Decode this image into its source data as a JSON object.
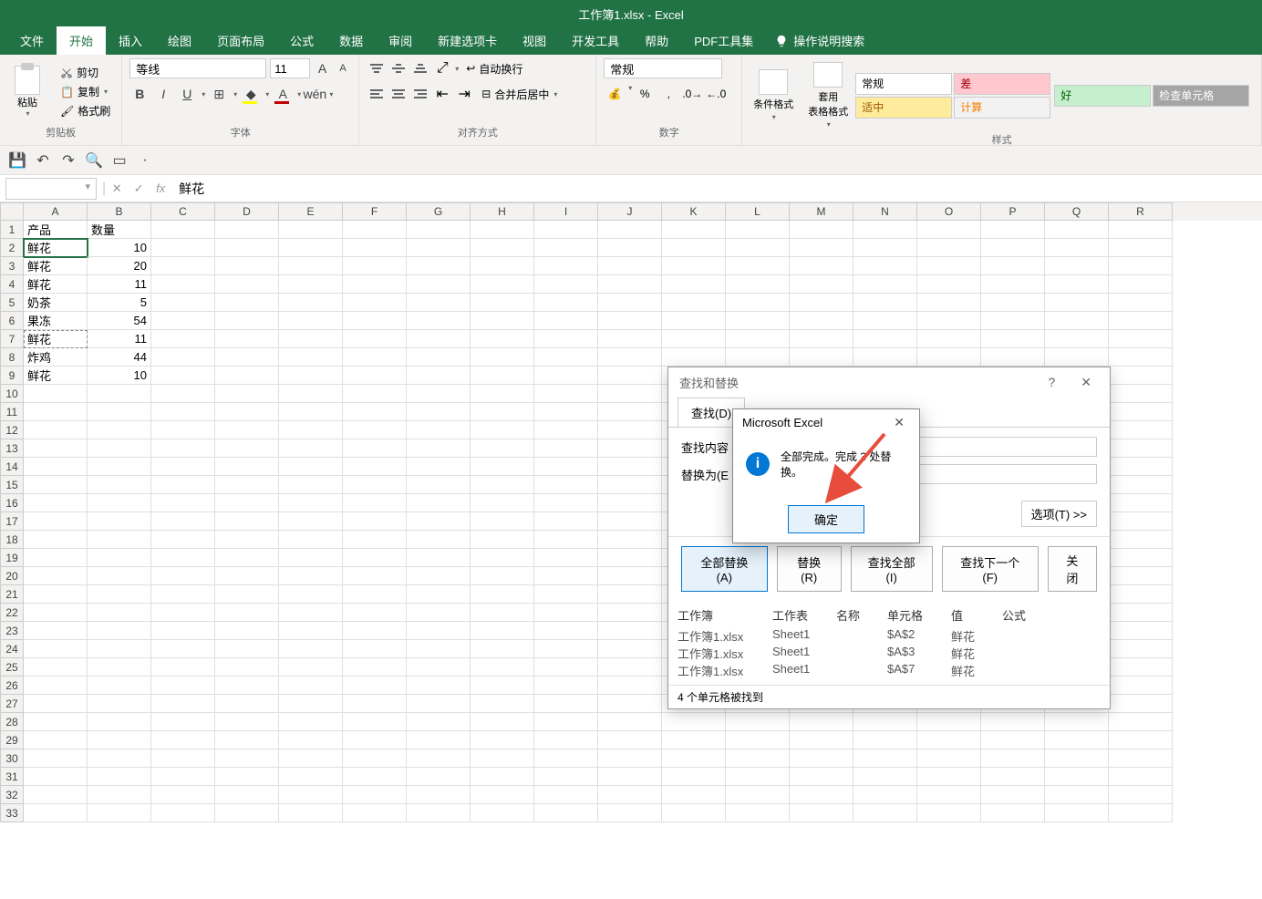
{
  "app": {
    "title": "工作簿1.xlsx - Excel"
  },
  "tabs": {
    "file": "文件",
    "home": "开始",
    "insert": "插入",
    "draw": "绘图",
    "layout": "页面布局",
    "formulas": "公式",
    "data": "数据",
    "review": "审阅",
    "newtab": "新建选项卡",
    "view": "视图",
    "developer": "开发工具",
    "help": "帮助",
    "pdf": "PDF工具集",
    "tellme": "操作说明搜索"
  },
  "ribbon": {
    "clipboard": {
      "label": "剪贴板",
      "paste": "粘贴",
      "cut": "剪切",
      "copy": "复制",
      "format_painter": "格式刷"
    },
    "font": {
      "label": "字体",
      "name": "等线",
      "size": "11"
    },
    "alignment": {
      "label": "对齐方式",
      "wrap": "自动换行",
      "merge": "合并后居中"
    },
    "number": {
      "label": "数字",
      "format": "常规"
    },
    "styles": {
      "label": "样式",
      "cond_format": "条件格式",
      "table_format": "套用\n表格格式",
      "normal": "常规",
      "bad": "差",
      "good": "好",
      "neutral": "适中",
      "calc": "计算",
      "check": "检查单元格"
    }
  },
  "formula_bar": {
    "name_box": "",
    "value": "鲜花"
  },
  "columns": [
    "A",
    "B",
    "C",
    "D",
    "E",
    "F",
    "G",
    "H",
    "I",
    "J",
    "K",
    "L",
    "M",
    "N",
    "O",
    "P",
    "Q",
    "R"
  ],
  "sheet": {
    "headers": {
      "a": "产品",
      "b": "数量"
    },
    "rows": [
      {
        "a": "鲜花",
        "b": "10"
      },
      {
        "a": "鲜花",
        "b": "20"
      },
      {
        "a": "鲜花",
        "b": "11"
      },
      {
        "a": "奶茶",
        "b": "5"
      },
      {
        "a": "果冻",
        "b": "54"
      },
      {
        "a": "鲜花",
        "b": "11"
      },
      {
        "a": "炸鸡",
        "b": "44"
      },
      {
        "a": "鲜花",
        "b": "10"
      }
    ]
  },
  "find_replace": {
    "title": "查找和替换",
    "tab_find": "查找(D)",
    "find_label": "查找内容",
    "replace_label": "替换为(E",
    "options": "选项(T) >>",
    "replace_all": "全部替换(A)",
    "replace": "替换(R)",
    "find_all": "查找全部(I)",
    "find_next": "查找下一个(F)",
    "close": "关闭",
    "cols": {
      "book": "工作簿",
      "sheet": "工作表",
      "name": "名称",
      "cell": "单元格",
      "value": "值",
      "formula": "公式"
    },
    "results": [
      {
        "book": "工作簿1.xlsx",
        "sheet": "Sheet1",
        "cell": "$A$2",
        "value": "鲜花"
      },
      {
        "book": "工作簿1.xlsx",
        "sheet": "Sheet1",
        "cell": "$A$3",
        "value": "鲜花"
      },
      {
        "book": "工作簿1.xlsx",
        "sheet": "Sheet1",
        "cell": "$A$7",
        "value": "鲜花"
      }
    ],
    "status": "4 个单元格被找到"
  },
  "msgbox": {
    "title": "Microsoft Excel",
    "message": "全部完成。完成 3 处替换。",
    "ok": "确定"
  }
}
